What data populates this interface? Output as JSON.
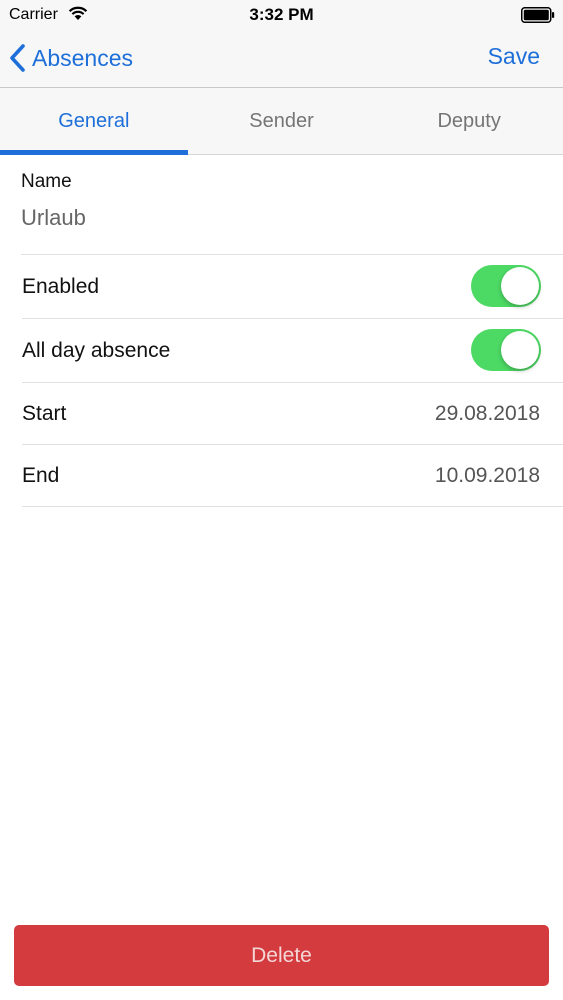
{
  "status_bar": {
    "carrier": "Carrier",
    "time": "3:32 PM",
    "wifi_icon": "wifi-icon",
    "battery_icon": "battery-icon"
  },
  "nav": {
    "back_label": "Absences",
    "back_icon": "chevron-left-icon",
    "save_label": "Save"
  },
  "tabs": [
    {
      "label": "General",
      "active": true
    },
    {
      "label": "Sender",
      "active": false
    },
    {
      "label": "Deputy",
      "active": false
    }
  ],
  "form": {
    "name_label": "Name",
    "name_value": "Urlaub",
    "enabled": {
      "label": "Enabled",
      "on": true
    },
    "all_day": {
      "label": "All day absence",
      "on": true
    },
    "start": {
      "label": "Start",
      "value": "29.08.2018"
    },
    "end": {
      "label": "End",
      "value": "10.09.2018"
    }
  },
  "delete_label": "Delete",
  "colors": {
    "accent": "#1e6fd9",
    "toggle_on": "#4cd964",
    "delete": "#d33b3f"
  }
}
